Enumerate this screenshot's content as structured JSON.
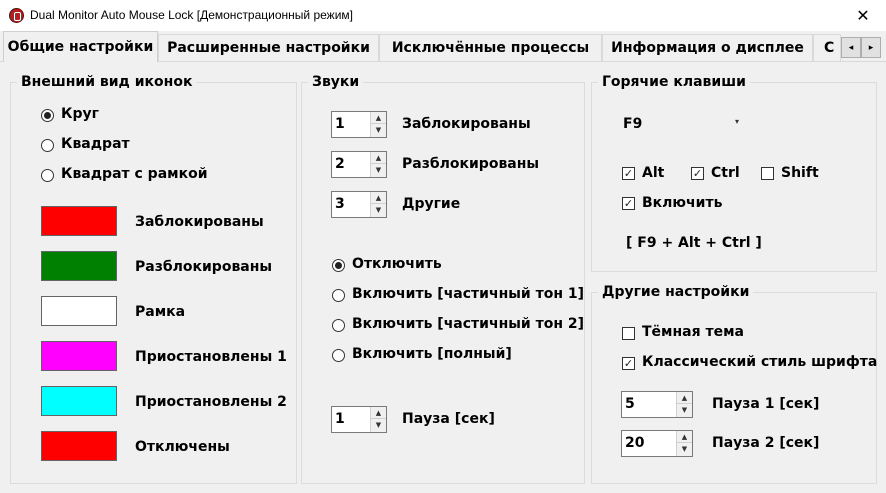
{
  "window": {
    "title": "Dual Monitor Auto Mouse Lock [Демонстрационный режим]",
    "close_glyph": "✕"
  },
  "tabs": [
    {
      "label": "Общие настройки",
      "active": true
    },
    {
      "label": "Расширенные настройки",
      "active": false
    },
    {
      "label": "Исключённые процессы",
      "active": false
    },
    {
      "label": "Информация о дисплее",
      "active": false
    },
    {
      "label": "С",
      "active": false
    }
  ],
  "tab_scroll": {
    "left": "◂",
    "right": "▸"
  },
  "icon_appearance": {
    "title": "Внешний вид иконок",
    "shapes": [
      {
        "label": "Круг",
        "checked": true
      },
      {
        "label": "Квадрат",
        "checked": false
      },
      {
        "label": "Квадрат с рамкой",
        "checked": false
      }
    ],
    "colors": [
      {
        "label": "Заблокированы",
        "color": "#ff0000"
      },
      {
        "label": "Разблокированы",
        "color": "#008000"
      },
      {
        "label": "Рамка",
        "color": "#ffffff"
      },
      {
        "label": "Приостановлены 1",
        "color": "#ff00ff"
      },
      {
        "label": "Приостановлены 2",
        "color": "#00ffff"
      },
      {
        "label": "Отключены",
        "color": "#ff0000"
      }
    ]
  },
  "sounds": {
    "title": "Звуки",
    "spinners": [
      {
        "value": "1",
        "label": "Заблокированы"
      },
      {
        "value": "2",
        "label": "Разблокированы"
      },
      {
        "value": "3",
        "label": "Другие"
      }
    ],
    "modes": [
      {
        "label": "Отключить",
        "checked": true
      },
      {
        "label": "Включить [частичный тон 1]",
        "checked": false
      },
      {
        "label": "Включить [частичный тон 2]",
        "checked": false
      },
      {
        "label": "Включить [полный]",
        "checked": false
      }
    ],
    "pause": {
      "value": "1",
      "label": "Пауза [сек]"
    }
  },
  "hotkeys": {
    "title": "Горячие клавиши",
    "key": "F9",
    "modifiers": [
      {
        "label": "Alt",
        "checked": true
      },
      {
        "label": "Ctrl",
        "checked": true
      },
      {
        "label": "Shift",
        "checked": false
      }
    ],
    "enable": {
      "label": "Включить",
      "checked": true
    },
    "combo_display": "[ F9 + Alt + Ctrl ]"
  },
  "other": {
    "title": "Другие настройки",
    "dark_theme": {
      "label": "Тёмная тема",
      "checked": false
    },
    "classic_font": {
      "label": "Классический стиль шрифта",
      "checked": true
    },
    "pause1": {
      "value": "5",
      "label": "Пауза 1 [сек]"
    },
    "pause2": {
      "value": "20",
      "label": "Пауза 2 [сек]"
    }
  },
  "glyphs": {
    "check": "✓",
    "spin_up": "▲",
    "spin_down": "▼",
    "dropdown": "▾"
  }
}
